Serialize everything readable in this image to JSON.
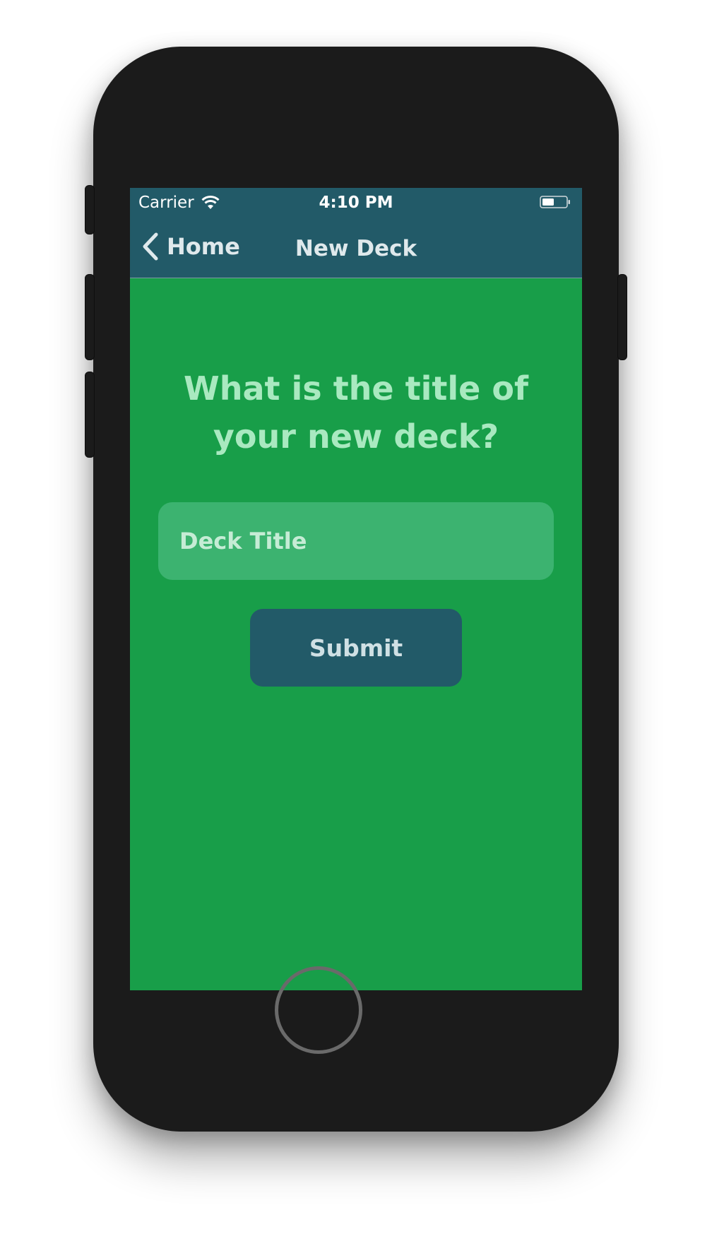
{
  "status_bar": {
    "carrier": "Carrier",
    "time": "4:10 PM",
    "wifi_icon": "wifi-icon",
    "battery_icon": "battery-icon"
  },
  "nav": {
    "back_label": "Home",
    "back_icon": "chevron-left-icon",
    "title": "New Deck"
  },
  "form": {
    "question": "What is the title of your new deck?",
    "input_placeholder": "Deck Title",
    "input_value": "",
    "submit_label": "Submit"
  },
  "colors": {
    "header": "#225a68",
    "background": "#189e49",
    "input": "#3cb370",
    "question_text": "#a9e9c0",
    "button": "#225a68"
  }
}
